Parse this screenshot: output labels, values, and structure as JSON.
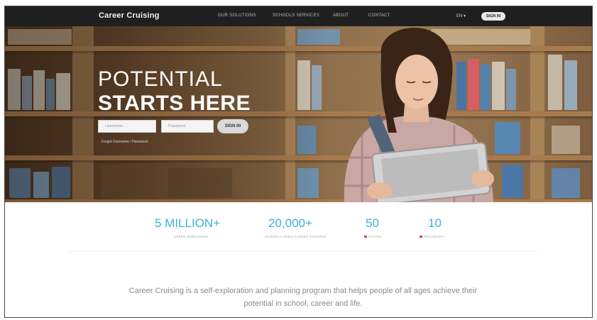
{
  "nav": {
    "logo": "Career Cruising",
    "links": [
      "OUR SOLUTIONS",
      "SCHOOLS SERVICES",
      "ABOUT",
      "CONTACT"
    ],
    "language": "EN ▾",
    "sign_in": "SIGN IN"
  },
  "hero": {
    "line1": "POTENTIAL",
    "line2": "STARTS HERE",
    "username_placeholder": "Username",
    "password_placeholder": "Password",
    "sign_in": "SIGN IN",
    "forgot": "Forgot Username / Password"
  },
  "stats": [
    {
      "value": "5 MILLION+",
      "label": "USERS WORLDWIDE"
    },
    {
      "value": "20,000+",
      "label": "SCHOOLS USING CAREER CRUISING"
    },
    {
      "value": "50",
      "label": "STATES"
    },
    {
      "value": "10",
      "label": "PROVINCES"
    }
  ],
  "description": "Career Cruising is a self-exploration and planning program that helps people of all ages achieve their potential in school, career and life.",
  "colors": {
    "nav_bg": "#1f1f1f",
    "accent": "#3ab0dd",
    "flag": "#e0415a"
  }
}
